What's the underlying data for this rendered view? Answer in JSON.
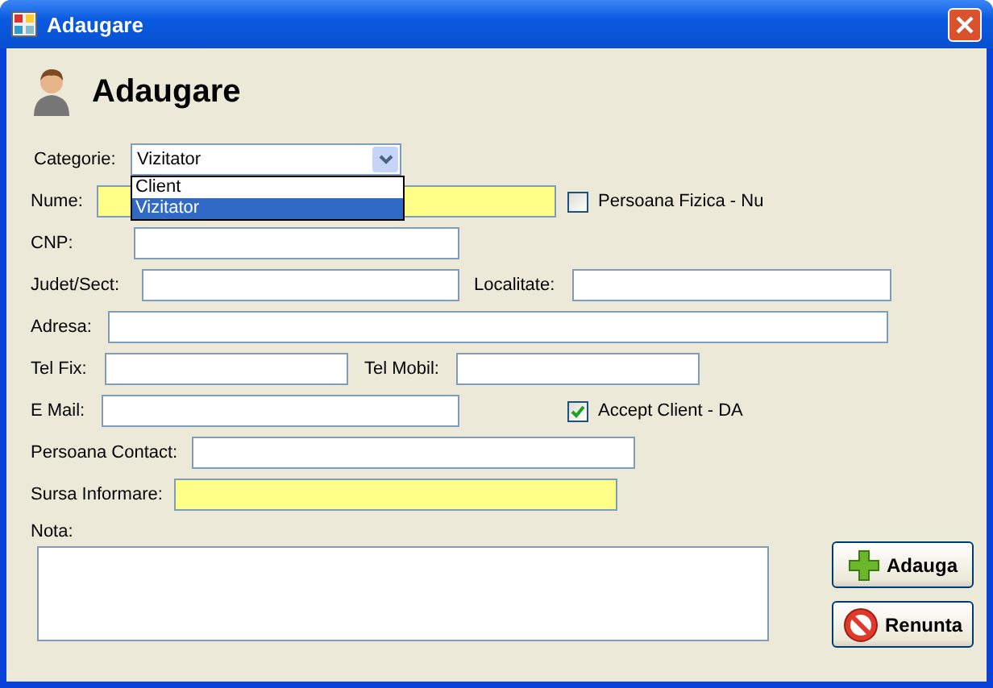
{
  "window": {
    "title": "Adaugare"
  },
  "header": {
    "title": "Adaugare"
  },
  "categorie": {
    "label": "Categorie:",
    "value": "Vizitator",
    "expanded": true,
    "options": [
      {
        "label": "Client",
        "selected": false
      },
      {
        "label": "Vizitator",
        "selected": true
      }
    ]
  },
  "fields": [
    {
      "label": "Nume:",
      "required": true
    },
    {
      "label": "CNP:",
      "required": false
    },
    {
      "label": "Judet/Sect:",
      "required": false
    },
    {
      "label": "Localitate:",
      "required": false
    },
    {
      "label": "Adresa:",
      "required": false
    },
    {
      "label": "Tel Fix:",
      "required": false
    },
    {
      "label": "Tel Mobil:",
      "required": false
    },
    {
      "label": "E Mail:",
      "required": false
    },
    {
      "label": "Persoana Contact:",
      "required": false
    },
    {
      "label": "Sursa Informare:",
      "required": true
    }
  ],
  "checkboxes": [
    {
      "label": "Persoana Fizica - Nu",
      "checked": false
    },
    {
      "label": "Accept Client - DA",
      "checked": true
    }
  ],
  "nota": {
    "label": "Nota:"
  },
  "buttons": [
    {
      "kind": "add",
      "label": "Adauga"
    },
    {
      "kind": "cancel",
      "label": "Renunta"
    }
  ]
}
